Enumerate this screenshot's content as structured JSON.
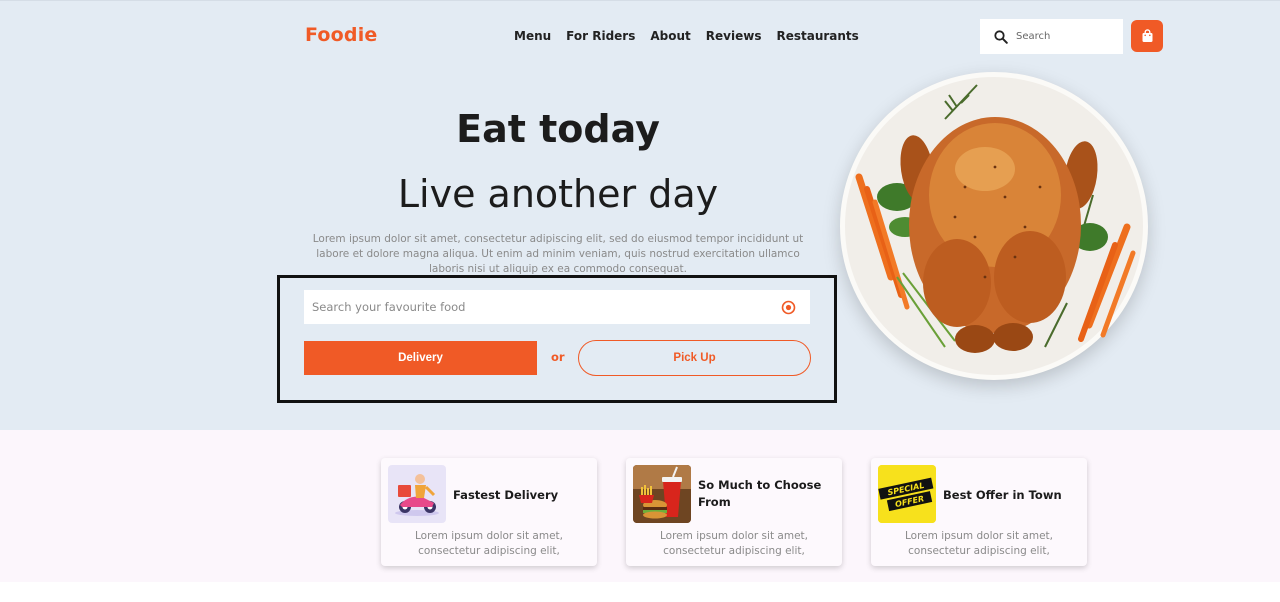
{
  "header": {
    "brand": "Foodie",
    "nav": [
      "Menu",
      "For Riders",
      "About",
      "Reviews",
      "Restaurants"
    ],
    "search_placeholder": "Search",
    "accent_color": "#f05a26"
  },
  "hero": {
    "headline": "Eat today",
    "subline": "Live another day",
    "body": "Lorem ipsum dolor sit amet, consectetur adipiscing elit, sed do eiusmod tempor incididunt ut labore et dolore magna aliqua. Ut enim ad minim veniam, quis nostrud exercitation ullamco laboris nisi ut aliquip ex ea commodo consequat.",
    "food_search_placeholder": "Search your favourite food",
    "delivery_label": "Delivery",
    "or_label": "or",
    "pickup_label": "Pick Up"
  },
  "features": [
    {
      "title": "Fastest Delivery",
      "desc": "Lorem ipsum dolor sit amet, consectetur adipiscing elit,",
      "icon": "delivery-scooter-icon"
    },
    {
      "title": "So Much to Choose From",
      "desc": "Lorem ipsum dolor sit amet, consectetur adipiscing elit,",
      "icon": "burger-meal-icon"
    },
    {
      "title": "Best Offer in Town",
      "desc": "Lorem ipsum dolor sit amet, consectetur adipiscing elit,",
      "icon": "special-offer-icon",
      "badge_line1": "SPECIAL",
      "badge_line2": "OFFER"
    }
  ]
}
